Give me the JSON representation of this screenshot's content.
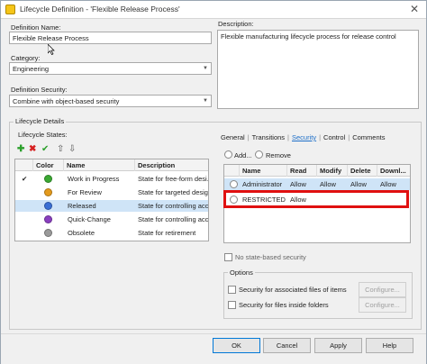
{
  "window": {
    "title": "Lifecycle Definition - 'Flexible Release Process'"
  },
  "definition": {
    "name_label": "Definition Name:",
    "name_value": "Flexible Release Process",
    "category_label": "Category:",
    "category_value": "Engineering",
    "security_label": "Definition Security:",
    "security_value": "Combine with object-based security",
    "description_label": "Description:",
    "description_value": "Flexible manufacturing lifecycle process for release control"
  },
  "lifecycle_details": {
    "group_label": "Lifecycle Details",
    "states_label": "Lifecycle States:",
    "columns": [
      "",
      "Color",
      "Name",
      "Description"
    ],
    "states": [
      {
        "check": "✔",
        "name": "Work in Progress",
        "description": "State for free-form desi...",
        "color": "#3aa832"
      },
      {
        "check": "",
        "name": "For Review",
        "description": "State for targeted design...",
        "color": "#e39a1c"
      },
      {
        "check": "",
        "name": "Released",
        "description": "State for controlling acc...",
        "color": "#3b6fd4"
      },
      {
        "check": "",
        "name": "Quick-Change",
        "description": "State for controlling acc...",
        "color": "#8a3fbf"
      },
      {
        "check": "",
        "name": "Obsolete",
        "description": "State for retirement",
        "color": "#9a9a9a"
      }
    ]
  },
  "tabs": [
    {
      "label": "General",
      "active": false
    },
    {
      "label": "Transitions",
      "active": false
    },
    {
      "label": "Security",
      "active": true
    },
    {
      "label": "Control",
      "active": false
    },
    {
      "label": "Comments",
      "active": false
    }
  ],
  "security": {
    "add_label": "Add...",
    "remove_label": "Remove",
    "columns": [
      "Name",
      "Read",
      "Modify",
      "Delete",
      "Downl..."
    ],
    "rows": [
      {
        "name": "Administrator",
        "read": "Allow",
        "modify": "Allow",
        "delete": "Allow",
        "download": "Allow"
      },
      {
        "name": "RESTRICTED ...",
        "read": "Allow",
        "modify": "",
        "delete": "",
        "download": ""
      }
    ],
    "no_state_security_label": "No state-based security",
    "options_label": "Options",
    "assoc_files_label": "Security for associated files of items",
    "inside_folders_label": "Security for files inside folders",
    "configure_label": "Configure..."
  },
  "buttons": {
    "ok": "OK",
    "cancel": "Cancel",
    "apply": "Apply",
    "help": "Help"
  }
}
